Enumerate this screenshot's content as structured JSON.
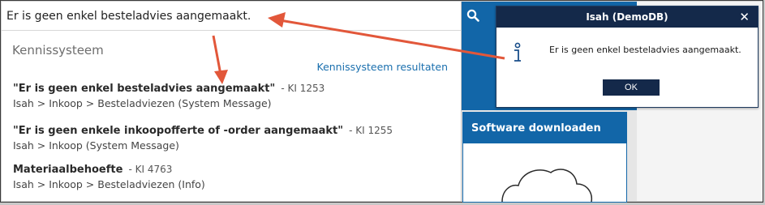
{
  "search": {
    "value": "Er is geen enkel besteladvies aangemaakt.",
    "button_icon": "search-icon"
  },
  "knowledge": {
    "section_title": "Kennissysteem",
    "results_link": "Kennissysteem resultaten",
    "results": [
      {
        "title": "\"Er is geen enkel besteladvies aangemaakt\"",
        "ki": "- KI 1253",
        "path": "Isah > Inkoop > Besteladviezen (System Message)"
      },
      {
        "title": "\"Er is geen enkele inkoopofferte of -order aangemaakt\"",
        "ki": "- KI 1255",
        "path": "Isah > Inkoop (System Message)"
      },
      {
        "title": "Materiaalbehoefte",
        "ki": "- KI 4763",
        "path": "Isah > Inkoop > Besteladviezen (Info)"
      }
    ]
  },
  "download": {
    "title": "Software downloaden",
    "icon": "cloud-icon"
  },
  "dialog": {
    "title": "Isah (DemoDB)",
    "message": "Er is geen enkel besteladvies aangemaakt.",
    "ok_label": "OK",
    "close_icon": "close-icon",
    "info_icon": "info-icon"
  },
  "colors": {
    "brand_blue": "#1266a8",
    "dialog_navy": "#14294a",
    "link_blue": "#1a6fae",
    "arrow_red": "#e2573a"
  }
}
